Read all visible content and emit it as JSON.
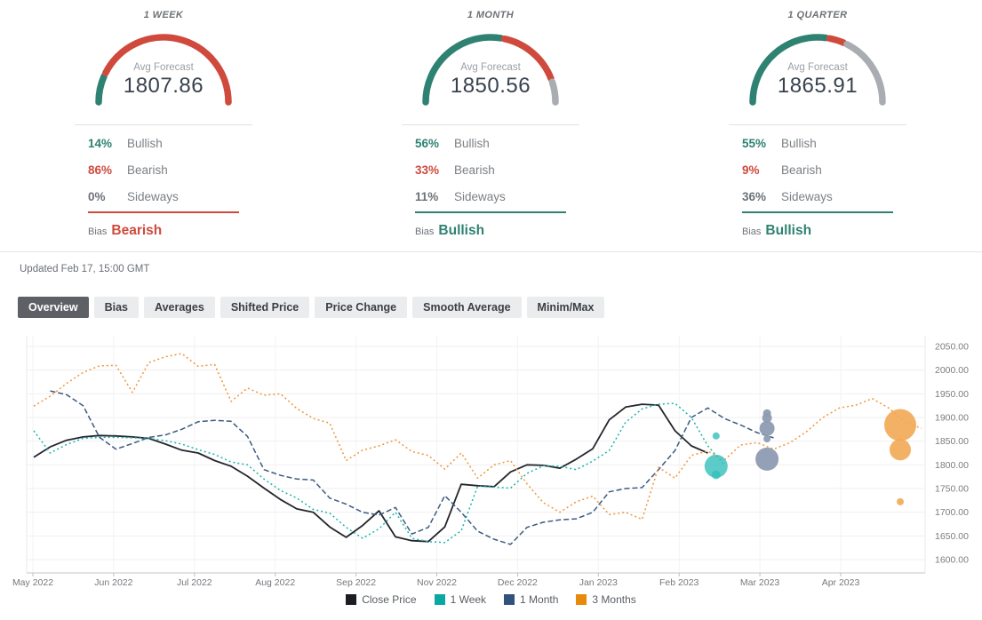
{
  "cards": [
    {
      "period": "1 WEEK",
      "avg_label": "Avg Forecast",
      "avg_value": "1807.86",
      "gauge": {
        "bullish": 14,
        "bearish": 86,
        "sideways": 0
      },
      "stats": [
        {
          "pct": "14%",
          "label": "Bullish",
          "color": "#2f8272"
        },
        {
          "pct": "86%",
          "label": "Bearish",
          "color": "#cf4a3d"
        },
        {
          "pct": "0%",
          "label": "Sideways",
          "color": "#6d7278"
        }
      ],
      "bias_label": "Bias",
      "bias_value": "Bearish",
      "bias_color": "#cf4a3d"
    },
    {
      "period": "1 MONTH",
      "avg_label": "Avg Forecast",
      "avg_value": "1850.56",
      "gauge": {
        "bullish": 56,
        "bearish": 33,
        "sideways": 11
      },
      "stats": [
        {
          "pct": "56%",
          "label": "Bullish",
          "color": "#2f8272"
        },
        {
          "pct": "33%",
          "label": "Bearish",
          "color": "#cf4a3d"
        },
        {
          "pct": "11%",
          "label": "Sideways",
          "color": "#6d7278"
        }
      ],
      "bias_label": "Bias",
      "bias_value": "Bullish",
      "bias_color": "#2f8272"
    },
    {
      "period": "1 QUARTER",
      "avg_label": "Avg Forecast",
      "avg_value": "1865.91",
      "gauge": {
        "bullish": 55,
        "bearish": 9,
        "sideways": 36
      },
      "stats": [
        {
          "pct": "55%",
          "label": "Bullish",
          "color": "#2f8272"
        },
        {
          "pct": "9%",
          "label": "Bearish",
          "color": "#cf4a3d"
        },
        {
          "pct": "36%",
          "label": "Sideways",
          "color": "#6d7278"
        }
      ],
      "bias_label": "Bias",
      "bias_value": "Bullish",
      "bias_color": "#2f8272"
    }
  ],
  "gauge_colors": {
    "bullish": "#2f8272",
    "bearish": "#cf4a3d",
    "sideways": "#a9acb0"
  },
  "meta": {
    "updated": "Updated Feb 17, 15:00 GMT"
  },
  "tabs": [
    {
      "label": "Overview",
      "active": true
    },
    {
      "label": "Bias",
      "active": false
    },
    {
      "label": "Averages",
      "active": false
    },
    {
      "label": "Shifted Price",
      "active": false
    },
    {
      "label": "Price Change",
      "active": false
    },
    {
      "label": "Smooth Average",
      "active": false
    },
    {
      "label": "Minim/Max",
      "active": false
    }
  ],
  "chart_data": {
    "type": "line",
    "x_labels": [
      "May 2022",
      "Jun 2022",
      "Jul 2022",
      "Aug 2022",
      "Sep 2022",
      "Nov 2022",
      "Dec 2022",
      "Jan 2023",
      "Feb 2023",
      "Mar 2023",
      "Apr 2023"
    ],
    "y_ticks": [
      2050,
      2000,
      1950,
      1900,
      1850,
      1800,
      1750,
      1700,
      1650,
      1600
    ],
    "ylim": [
      1600,
      2050
    ],
    "grid": true,
    "legend_position": "bottom",
    "series": [
      {
        "name": "Close Price",
        "color": "#23262d",
        "width": 1.8,
        "dash": "",
        "values": [
          1816,
          1838,
          1852,
          1859,
          1862,
          1861,
          1859,
          1856,
          1844,
          1831,
          1825,
          1809,
          1797,
          1776,
          1751,
          1727,
          1707,
          1700,
          1669,
          1647,
          1672,
          1703,
          1648,
          1640,
          1638,
          1669,
          1759,
          1756,
          1754,
          1785,
          1800,
          1799,
          1793,
          1812,
          1834,
          1895,
          1922,
          1928,
          1926,
          1872,
          1840,
          1825
        ]
      },
      {
        "name": "1 Week",
        "color": "#1ab3ae",
        "width": 1.5,
        "dash": "2 3",
        "values": [
          1872,
          1825,
          1843,
          1856,
          1858,
          1858,
          1857,
          1856,
          1851,
          1844,
          1832,
          1822,
          1806,
          1800,
          1770,
          1746,
          1730,
          1706,
          1698,
          1668,
          1645,
          1665,
          1700,
          1645,
          1638,
          1636,
          1661,
          1755,
          1753,
          1751,
          1782,
          1798,
          1797,
          1790,
          1808,
          1830,
          1890,
          1918,
          1928,
          1930,
          1900,
          1840,
          1800
        ]
      },
      {
        "name": "1 Month",
        "color": "#3c5a80",
        "width": 1.5,
        "dash": "6 3",
        "values": [
          null,
          1956,
          1948,
          1925,
          1858,
          1833,
          1845,
          1858,
          1863,
          1875,
          1891,
          1894,
          1892,
          1860,
          1790,
          1778,
          1770,
          1768,
          1730,
          1717,
          1700,
          1694,
          1710,
          1654,
          1668,
          1735,
          1700,
          1660,
          1643,
          1632,
          1668,
          1679,
          1684,
          1686,
          1700,
          1743,
          1750,
          1752,
          1790,
          1830,
          1900,
          1920,
          1898,
          1884,
          1868,
          1857
        ]
      },
      {
        "name": "3 Months",
        "color": "#f0953a",
        "width": 1.5,
        "dash": "2 3",
        "values": [
          1924,
          1945,
          1972,
          1995,
          2009,
          2010,
          1953,
          2016,
          2028,
          2035,
          2008,
          2012,
          1934,
          1962,
          1947,
          1950,
          1919,
          1898,
          1888,
          1809,
          1831,
          1840,
          1853,
          1828,
          1820,
          1791,
          1825,
          1772,
          1800,
          1809,
          1760,
          1720,
          1700,
          1722,
          1734,
          1695,
          1700,
          1685,
          1795,
          1772,
          1820,
          1829,
          1810,
          1842,
          1847,
          1833,
          1847,
          1870,
          1900,
          1920,
          1926,
          1940,
          1920,
          1890,
          1877
        ]
      }
    ],
    "bubble_groups": [
      {
        "name": "1 Week forecasts",
        "color": "#35bfba",
        "opacity": 0.8,
        "x_index": 41.5,
        "points": [
          {
            "value": 1861,
            "r": 4
          },
          {
            "value": 1797,
            "r": 13
          },
          {
            "value": 1779,
            "r": 5
          }
        ]
      },
      {
        "name": "1 Month forecasts",
        "color": "#8d9bb1",
        "opacity": 0.95,
        "x_index": 44.6,
        "points": [
          {
            "value": 1909,
            "r": 4.5
          },
          {
            "value": 1899,
            "r": 5.5
          },
          {
            "value": 1877,
            "r": 8.5
          },
          {
            "value": 1855,
            "r": 4
          },
          {
            "value": 1812,
            "r": 13
          }
        ]
      },
      {
        "name": "3 Months forecasts",
        "color": "#f2a954",
        "opacity": 0.9,
        "x_index": 52.7,
        "points": [
          {
            "value": 1884,
            "r": 18
          },
          {
            "value": 1832,
            "r": 12
          },
          {
            "value": 1722,
            "r": 4
          }
        ]
      }
    ],
    "legend": [
      {
        "label": "Close Price",
        "color": "#1b1d22"
      },
      {
        "label": "1 Week",
        "color": "#0aa8a3"
      },
      {
        "label": "1 Month",
        "color": "#33527b"
      },
      {
        "label": "3 Months",
        "color": "#e8890c"
      }
    ]
  }
}
